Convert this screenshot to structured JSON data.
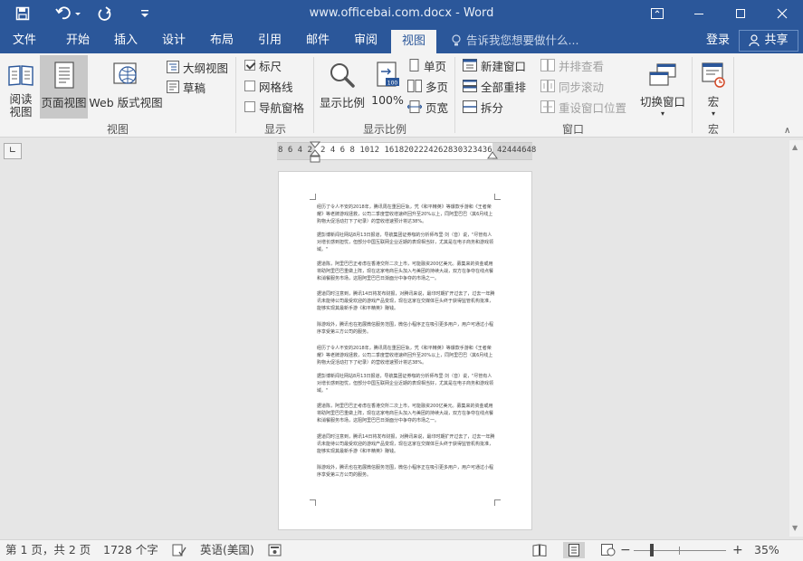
{
  "window": {
    "title": "www.officebai.com.docx - Word"
  },
  "tabs": [
    {
      "label": "文件",
      "active": false
    },
    {
      "label": "开始",
      "active": false
    },
    {
      "label": "插入",
      "active": false
    },
    {
      "label": "设计",
      "active": false
    },
    {
      "label": "布局",
      "active": false
    },
    {
      "label": "引用",
      "active": false
    },
    {
      "label": "邮件",
      "active": false
    },
    {
      "label": "审阅",
      "active": false
    },
    {
      "label": "视图",
      "active": true
    }
  ],
  "tell_me": "告诉我您想要做什么...",
  "account": {
    "login": "登录",
    "share": "共享"
  },
  "ribbon": {
    "views": {
      "group_label": "视图",
      "read_mode": "阅读视图",
      "print_layout": "页面视图",
      "web_layout": "Web 版式视图",
      "outline": "大纲视图",
      "draft": "草稿"
    },
    "show": {
      "group_label": "显示",
      "ruler": "标尺",
      "gridlines": "网格线",
      "nav_pane": "导航窗格",
      "ruler_checked": true,
      "gridlines_checked": false,
      "nav_pane_checked": false
    },
    "zoom": {
      "group_label": "显示比例",
      "zoom": "显示比例",
      "hundred": "100%",
      "one_page": "单页",
      "multi_page": "多页",
      "page_width": "页宽"
    },
    "window": {
      "group_label": "窗口",
      "new_window": "新建窗口",
      "arrange_all": "全部重排",
      "split": "拆分",
      "side_by_side": "并排查看",
      "sync_scroll": "同步滚动",
      "reset_position": "重设窗口位置",
      "switch_windows": "切换窗口"
    },
    "macros": {
      "group_label": "宏",
      "macros": "宏"
    }
  },
  "ruler": {
    "left_ticks": "8 6 4 2",
    "right_ticks": "2  4  6  8 1012   1618202224262830323436",
    "far_ticks": "42444648"
  },
  "document": {
    "paragraphs": [
      "经历了令人不安的2018年，腾讯周在重回巨轨，凭《和平精英》等爆款手游和《王者荣耀》等老牌游戏拯救，公司二季度营收增速终回升至20%以上，同阿里巴巴（其6月线上购物大促活动打下了纪录）的营收增速预计将达38%。",
      "据彭博新闻社网站8月13日报道，导航集团证券咖的分析师布里·刘（音）说，\"尽管有人对增长感到担忧，但部分中国互联网企业近期的表现相当好，尤其是在电子商务和游戏领域。\"",
      "据道陈，阿里巴巴正考虑在香港交所二次上市，可能融资200亿美元。募集来的资金或用将助阿里巴巴重做上阵，现在这家电商巨头加入与美团的持续大战，双方在争夺在线点餐和消餐服务市场，这阻阿里巴巴日渐面分中争夺的市场之一。",
      "据道同时注意到，腾讯14日将发布财报，对腾讯来说，最印时期扩开过去了，过去一年腾讯未能待公司最受欢迎的游戏产品变现，现在这家在交媒体巨头终于获得监管机构批准，能够实现其最新手游《和平精英》赚钱。",
      "除游戏外，腾讯也在拓展微信服务范围，微信小程序正在吸引更多用户，用户可通过小程序享受第三方公司的服务。",
      "经历了令人不安的2018年，腾讯周在重回巨轨，凭《和平精英》等爆款手游和《王者荣耀》等老牌游戏拯救，公司二季度营收增速终回升至20%以上，同阿里巴巴（其6月线上购物大促活动打下了纪录）的营收增速预计将达38%。",
      "据彭博新闻社网站8月13日报道，导航集团证券咖的分析师布里·刘（音）说，\"尽管有人对增长感到担忧，但部分中国互联网企业近期的表现相当好，尤其是在电子商务和游戏领域。\"",
      "据道陈，阿里巴巴正考虑在香港交所二次上市，可能融资200亿美元。募集来的资金或用将助阿里巴巴重做上阵，现在这家电商巨头加入与美团的持续大战，双方在争夺在线点餐和消餐服务市场，这阻阿里巴巴日渐面分中争夺的市场之一。",
      "据道同时注意到，腾讯14日将发布财报，对腾讯来说，最印时期扩开过去了，过去一年腾讯未能待公司最受欢迎的游戏产品变现，现在这家在交媒体巨头终于获得监管机构批准，能够实现其最新手游《和平精英》赚钱。",
      "除游戏外，腾讯也在拓展微信服务范围，微信小程序正在吸引更多用户，用户可通过小程序享受第三方公司的服务。"
    ]
  },
  "status": {
    "page": "第 1 页，共 2 页",
    "words": "1728 个字",
    "language": "英语(美国)",
    "zoom": "35%",
    "zoom_percent": 35
  },
  "colors": {
    "accent": "#2b579a",
    "ribbon_bg": "#f3f3f3",
    "canvas": "#e6e6e6"
  }
}
